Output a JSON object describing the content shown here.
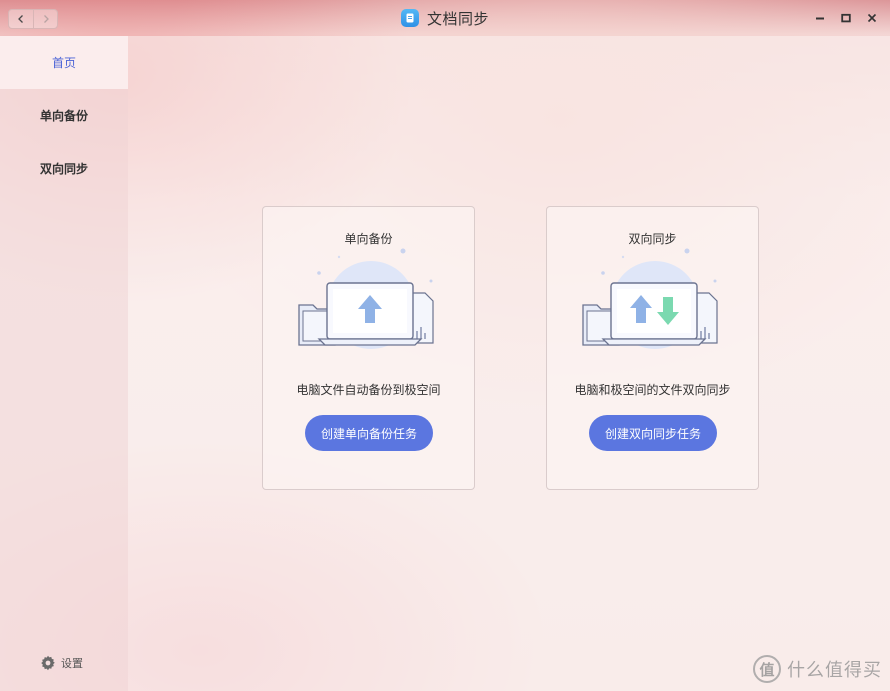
{
  "window": {
    "title": "文档同步",
    "app_icon": "document-sync-icon"
  },
  "sidebar": {
    "items": [
      {
        "label": "首页",
        "active": true
      },
      {
        "label": "单向备份",
        "active": false
      },
      {
        "label": "双向同步",
        "active": false
      }
    ],
    "settings_label": "设置"
  },
  "cards": [
    {
      "title": "单向备份",
      "description": "电脑文件自动备份到极空间",
      "button_label": "创建单向备份任务",
      "illustration": "upload-laptop-illustration"
    },
    {
      "title": "双向同步",
      "description": "电脑和极空间的文件双向同步",
      "button_label": "创建双向同步任务",
      "illustration": "two-way-sync-laptop-illustration"
    }
  ],
  "watermark": {
    "logo_char": "值",
    "text": "什么值得买"
  },
  "colors": {
    "accent": "#5b76e0",
    "active_nav_text": "#4b63d6",
    "upload_arrow": "#8fb2e6",
    "download_arrow": "#7bd9b0"
  }
}
